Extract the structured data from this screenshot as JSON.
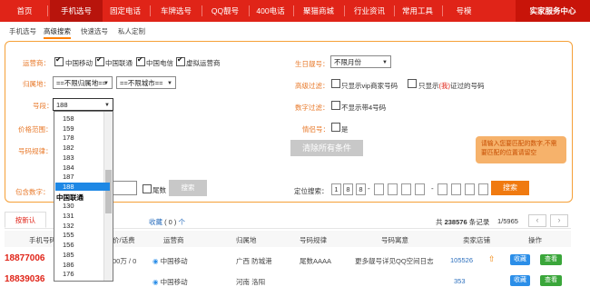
{
  "nav": {
    "items": [
      "首页",
      "手机选号",
      "固定电话",
      "车牌选号",
      "QQ靓号",
      "400电话",
      "聚猫商城",
      "行业资讯",
      "常用工具",
      "号模"
    ],
    "right_button": "实家服务中心"
  },
  "subtabs": [
    "手机选号",
    "高级搜索",
    "快速选号",
    "私人定制"
  ],
  "search": {
    "operator_label": "运营商：",
    "operators": [
      "中国移动",
      "中国联通",
      "中国电信",
      "虚拟运营商"
    ],
    "region_label": "归属地：",
    "region_province": "==不限归属地==",
    "region_city": "==不限城市==",
    "segment_label": "号段：",
    "segment_value": "188",
    "price_label": "价格范围：",
    "rule_label": "号码规律：",
    "contains_label": "包含数字：",
    "tail_label": "尾数",
    "search_btn": "搜索",
    "birthday_label": "生日靓号：",
    "birthday_value": "不限月份",
    "advanced_label": "高级过滤：",
    "advanced_opt1": "只显示vip商家号码",
    "advanced_opt2_a": "只显示",
    "advanced_opt2_b": "(我)",
    "advanced_opt2_c": "证过的号码",
    "digit_filter_label": "数字过滤：",
    "digit_filter_opt": "不显示带4号码",
    "lovers_label": "情侣号：",
    "lovers_opt": "是",
    "clear_btn": "清除所有条件",
    "position_label": "定位搜索：",
    "position_digits": [
      "1",
      "8",
      "8",
      "",
      "",
      "",
      "",
      "",
      "",
      "",
      ""
    ],
    "position_btn": "搜索",
    "tip": "请输入您要匹配的数字,不需要匹配的位置请留空"
  },
  "dropdown": {
    "items": [
      "158",
      "159",
      "178",
      "182",
      "183",
      "184",
      "187",
      "188"
    ],
    "group": "中国联通",
    "items2": [
      "130",
      "131",
      "132",
      "155",
      "156",
      "185",
      "186",
      "176"
    ],
    "highlighted": "188"
  },
  "results": {
    "tab": "按新认",
    "favorites": "收藏",
    "fav_count": "( 0 )",
    "fav_unit": "个",
    "total_prefix": "共",
    "total": "238576",
    "total_suffix": "条记录",
    "page": "1/5965",
    "prev": "‹",
    "next": "›"
  },
  "table": {
    "headers": [
      "手机号码",
      "价/话费",
      "运营商",
      "归属地",
      "号码规律",
      "号码寓意",
      "卖家店铺",
      "操作"
    ],
    "rows": [
      {
        "number": "18877006",
        "price": "00万 / 0",
        "operator": "中国移动",
        "region": "广西 防城港",
        "rule": "尾数AAAA",
        "meaning": "更多靓号详见QQ空间日志",
        "shop": "105526",
        "fav_btn": "收藏",
        "view_btn": "查看"
      },
      {
        "number": "18839036",
        "price": "",
        "operator": "中国移动",
        "region": "河南 洛阳",
        "rule": "",
        "meaning": "",
        "shop": "353",
        "fav_btn": "收藏",
        "view_btn": "查看"
      }
    ]
  }
}
